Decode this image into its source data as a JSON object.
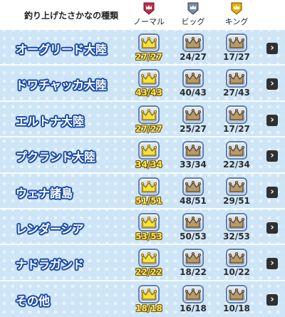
{
  "header": {
    "title": "釣り上げたさかなの種類",
    "columns": [
      {
        "label": "ノーマル",
        "icon": "red-crown-medal-icon",
        "color": "#c0304a"
      },
      {
        "label": "ビッグ",
        "icon": "silver-crown-medal-icon",
        "color": "#7a8ca8"
      },
      {
        "label": "キング",
        "icon": "gold-crown-medal-icon",
        "color": "#e6b400"
      }
    ]
  },
  "colors": {
    "gold_crown": "#f7e23a",
    "bronze_crown": "#b89a64",
    "done_count": "#ffe94d"
  },
  "rows": [
    {
      "name": "オーグリード大陸",
      "normal": "27/27",
      "big": "24/27",
      "king": "17/27"
    },
    {
      "name": "ドワチャッカ大陸",
      "normal": "43/43",
      "big": "40/43",
      "king": "27/43"
    },
    {
      "name": "エルトナ大陸",
      "normal": "27/27",
      "big": "25/27",
      "king": "17/27"
    },
    {
      "name": "プクランド大陸",
      "normal": "34/34",
      "big": "33/34",
      "king": "22/34"
    },
    {
      "name": "ウェナ諸島",
      "normal": "51/51",
      "big": "48/51",
      "king": "29/51"
    },
    {
      "name": "レンダーシア",
      "normal": "53/53",
      "big": "50/53",
      "king": "32/53"
    },
    {
      "name": "ナドラガンド",
      "normal": "22/22",
      "big": "18/22",
      "king": "10/22"
    },
    {
      "name": "その他",
      "normal": "18/18",
      "big": "16/18",
      "king": "10/18"
    }
  ]
}
